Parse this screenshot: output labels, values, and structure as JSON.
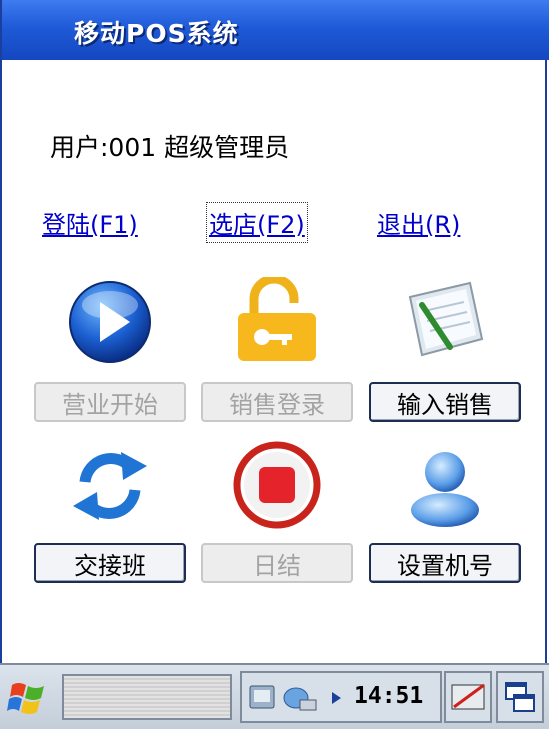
{
  "window": {
    "title": "移动POS系统"
  },
  "user_line": "用户:001 超级管理员",
  "links": {
    "login": "登陆(F1)",
    "select_store": "选店(F2)",
    "exit": "退出(R)"
  },
  "buttons": {
    "business_start": {
      "label": "营业开始",
      "enabled": false
    },
    "sales_login": {
      "label": "销售登录",
      "enabled": false
    },
    "input_sales": {
      "label": "输入销售",
      "enabled": true
    },
    "shift_handover": {
      "label": "交接班",
      "enabled": true
    },
    "day_end": {
      "label": "日结",
      "enabled": false
    },
    "set_machine_no": {
      "label": "设置机号",
      "enabled": true
    }
  },
  "icons": [
    "play-icon",
    "unlock-icon",
    "notepad-icon",
    "refresh-icon",
    "stop-icon",
    "user-icon"
  ],
  "taskbar": {
    "clock": "14:51"
  },
  "colors": {
    "titlebar": "#1f5ad8",
    "link": "#0000cc"
  }
}
